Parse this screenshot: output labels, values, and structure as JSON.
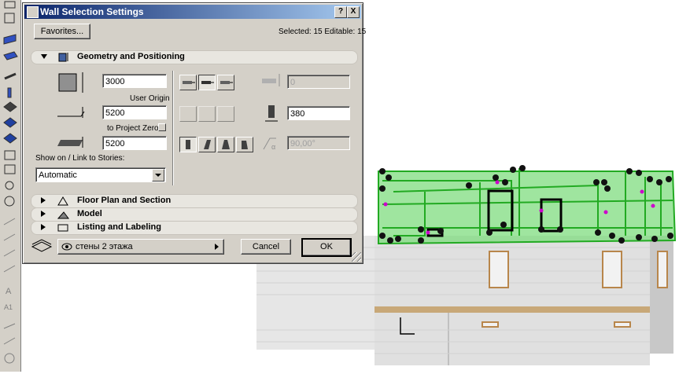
{
  "dialog": {
    "title": "Wall Selection Settings",
    "help_label": "?",
    "close_label": "X",
    "favorites_label": "Favorites...",
    "selected_info": "Selected: 15 Editable: 15",
    "sections": {
      "geometry": "Geometry and Positioning",
      "floor_plan": "Floor Plan and Section",
      "model": "Model",
      "listing": "Listing and Labeling"
    },
    "geometry": {
      "height_value": "3000",
      "height_ref": "User Origin",
      "base_value": "5200",
      "base_ref": "to Project Zero",
      "bottom_value": "5200",
      "show_on_label": "Show on / Link to Stories:",
      "show_on_value": "Automatic",
      "offset_value": "0",
      "thickness_value": "380",
      "angle_value": "90,00°"
    },
    "layer_value": "стены 2 этажа",
    "cancel_label": "Cancel",
    "ok_label": "OK"
  },
  "colors": {
    "selection_green": "#33cc33",
    "title_bar": "#0a246a",
    "dialog_face": "#d4d0c8"
  }
}
